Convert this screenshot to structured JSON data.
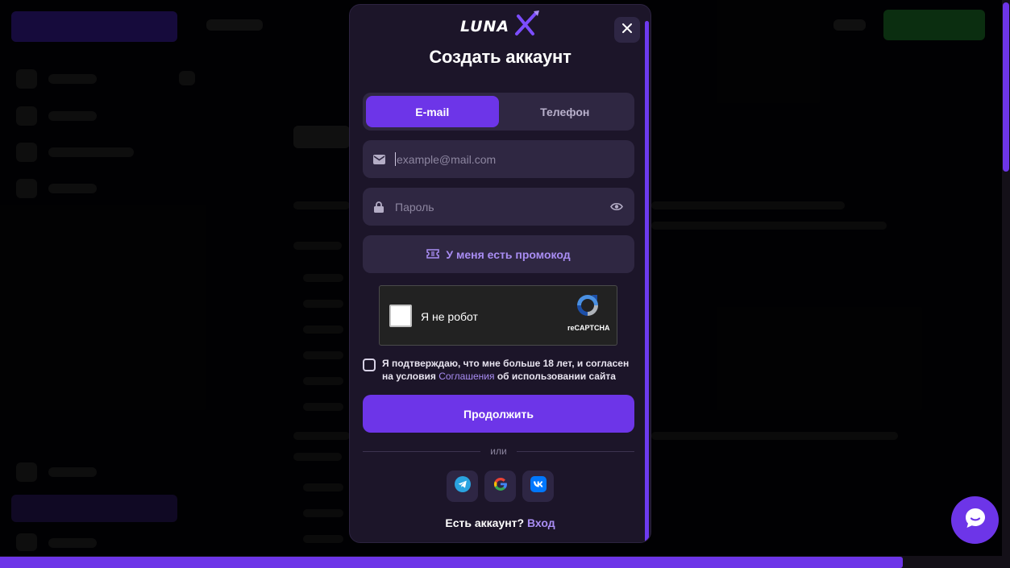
{
  "modal": {
    "title": "Создать аккаунт",
    "close_icon": "close-icon",
    "logo_icon": "lunax-logo"
  },
  "tabs": [
    {
      "label": "E-mail",
      "active": true
    },
    {
      "label": "Телефон",
      "active": false
    }
  ],
  "email": {
    "placeholder": "example@mail.com",
    "value": "",
    "icon": "mail-icon"
  },
  "password": {
    "placeholder": "Пароль",
    "value": "",
    "icon": "lock-icon",
    "toggle_icon": "eye-icon"
  },
  "promo": {
    "label": "У меня есть промокод",
    "icon": "ticket-icon"
  },
  "captcha": {
    "label": "Я не робот",
    "brand": "reCAPTCHA"
  },
  "agreement": {
    "text_before": "Я подтверждаю, что мне больше 18 лет, и согласен на условия",
    "link": "Соглашения",
    "text_after": "об использовании сайта",
    "checked": false
  },
  "submit_label": "Продолжить",
  "divider_label": "или",
  "socials": [
    {
      "name": "telegram",
      "icon": "telegram-icon"
    },
    {
      "name": "google",
      "icon": "google-icon"
    },
    {
      "name": "vk",
      "icon": "vk-icon"
    }
  ],
  "login": {
    "prompt": "Есть аккаунт?",
    "link": "Вход"
  },
  "colors": {
    "accent": "#6d35e8",
    "modal_bg": "#1c1529",
    "field_bg": "#2f2742",
    "link": "#a98df3"
  }
}
